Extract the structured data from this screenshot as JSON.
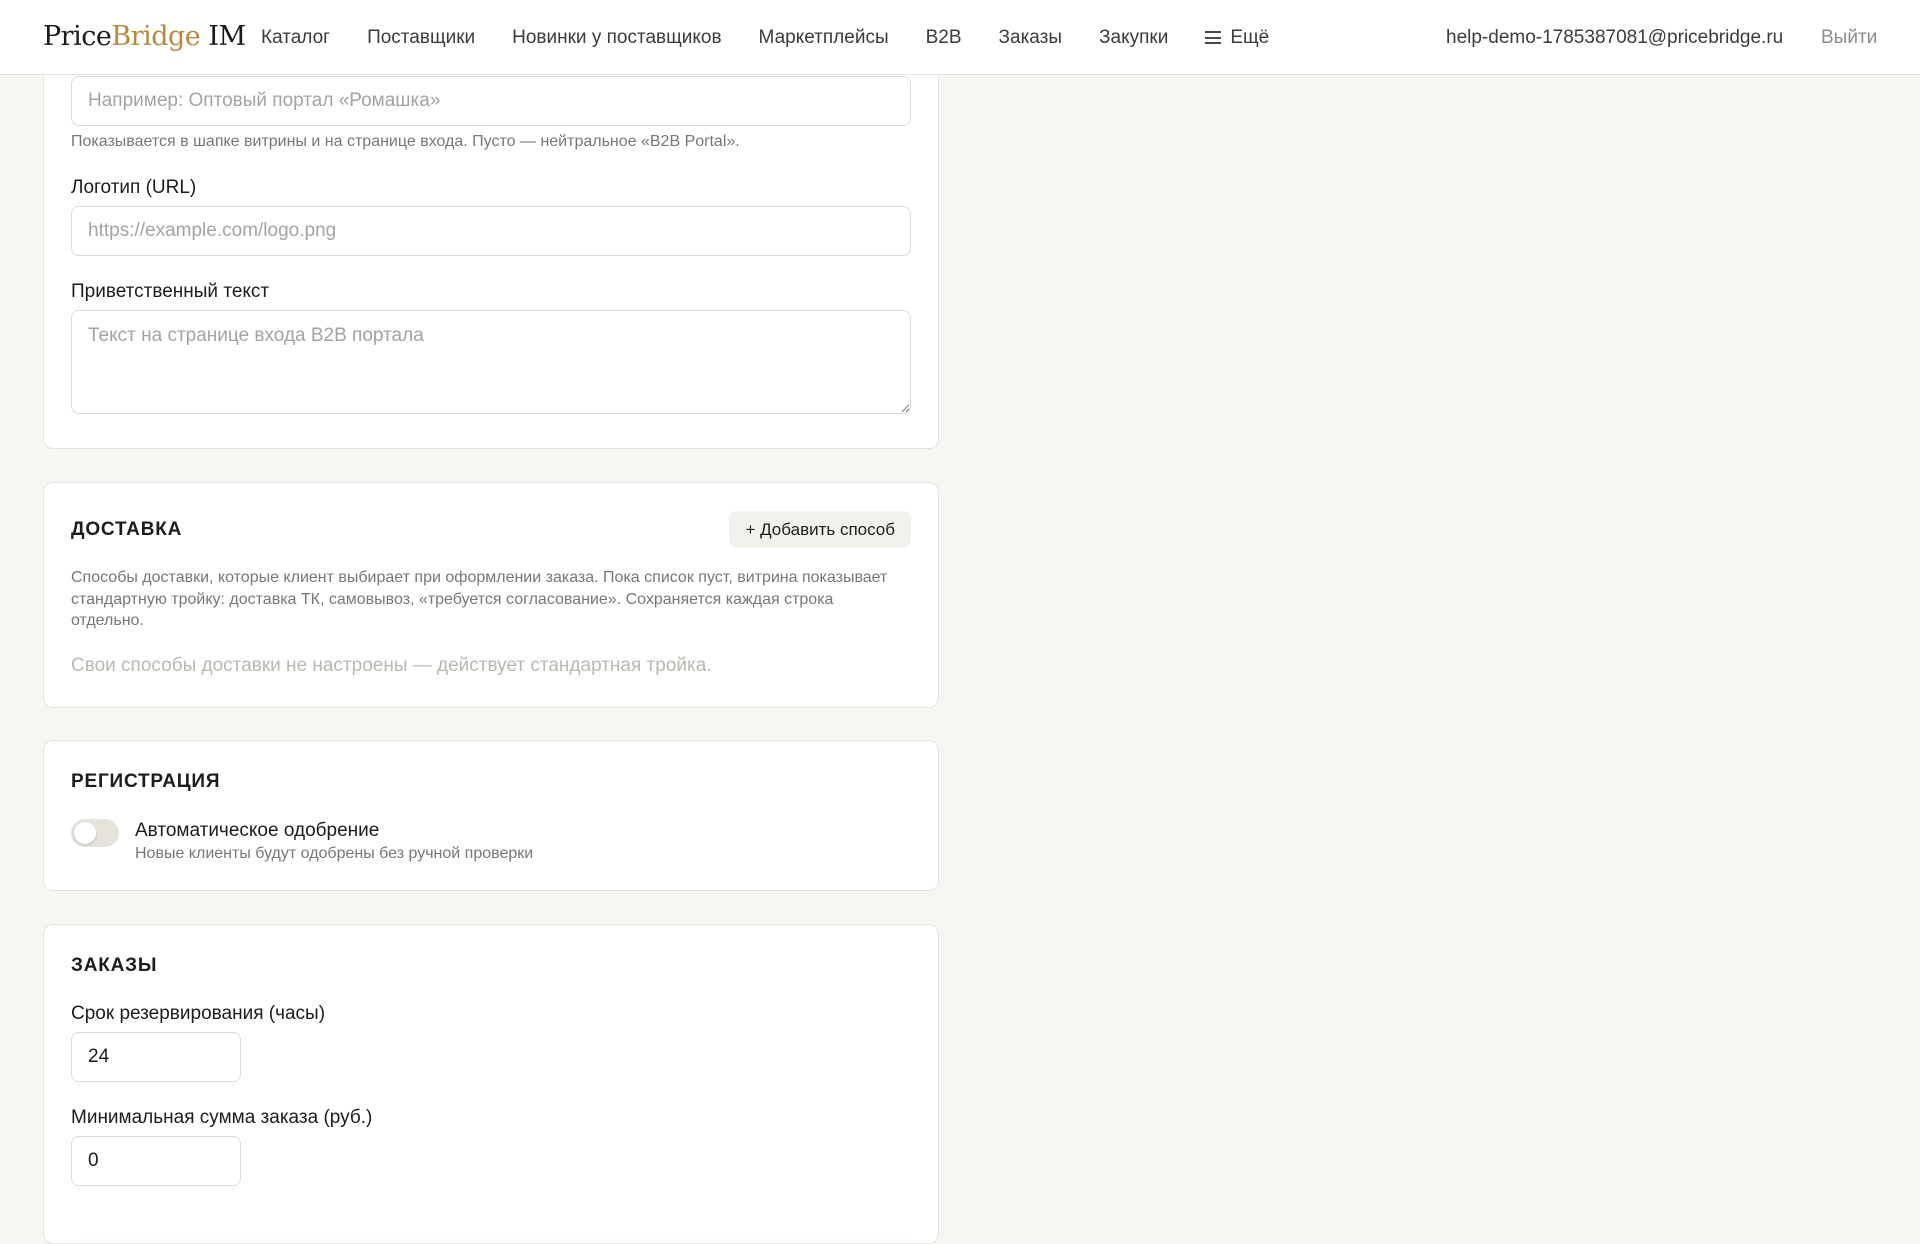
{
  "header": {
    "logo_part1": "Price",
    "logo_part2": "Bridge",
    "logo_part3": " IM",
    "nav": [
      {
        "label": "Каталог"
      },
      {
        "label": "Поставщики"
      },
      {
        "label": "Новинки у поставщиков"
      },
      {
        "label": "Маркетплейсы"
      },
      {
        "label": "B2B"
      },
      {
        "label": "Заказы"
      },
      {
        "label": "Закупки"
      }
    ],
    "more_label": "Ещё",
    "more_icon": "hamburger-icon",
    "user_email": "help-demo-1785387081@pricebridge.ru",
    "logout_label": "Выйти"
  },
  "branding": {
    "portal_name_placeholder": "Например: Оптовый портал «Ромашка»",
    "portal_name_value": "",
    "portal_name_hint": "Показывается в шапке витрины и на странице входа. Пусто — нейтральное «B2B Portal».",
    "logo_label": "Логотип (URL)",
    "logo_placeholder": "https://example.com/logo.png",
    "logo_value": "",
    "welcome_label": "Приветственный текст",
    "welcome_placeholder": "Текст на странице входа B2B портала",
    "welcome_value": ""
  },
  "delivery": {
    "title": "ДОСТАВКА",
    "add_button": "+ Добавить способ",
    "description": "Способы доставки, которые клиент выбирает при оформлении заказа. Пока список пуст, витрина показывает стандартную тройку: доставка ТК, самовывоз, «требуется согласование». Сохраняется каждая строка отдельно.",
    "empty_text": "Свои способы доставки не настроены — действует стандартная тройка."
  },
  "registration": {
    "title": "РЕГИСТРАЦИЯ",
    "auto_approve_label": "Автоматическое одобрение",
    "auto_approve_hint": "Новые клиенты будут одобрены без ручной проверки",
    "auto_approve_enabled": false
  },
  "orders": {
    "title": "ЗАКАЗЫ",
    "reserve_label": "Срок резервирования (часы)",
    "reserve_value": "24",
    "min_sum_label": "Минимальная сумма заказа (руб.)",
    "min_sum_value": "0"
  },
  "colors": {
    "background": "#f7f6f3",
    "logo_accent": "#b98a3e",
    "card_border": "#e7e4de",
    "muted_text": "#777777"
  }
}
